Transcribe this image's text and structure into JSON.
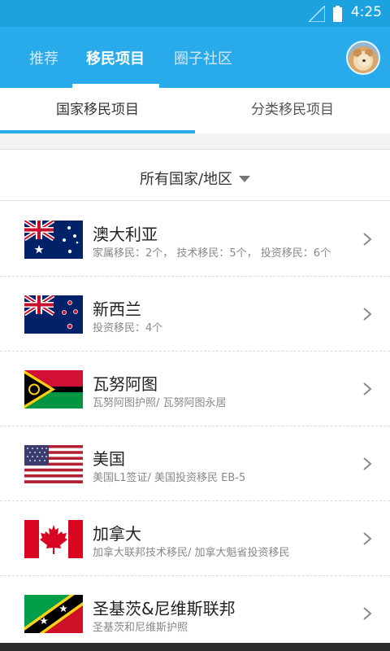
{
  "status_bar": {
    "time": "4:25"
  },
  "app_bar": {
    "tabs": [
      {
        "label": "推荐"
      },
      {
        "label": "移民项目"
      },
      {
        "label": "圈子社区"
      }
    ],
    "active_tab": "移民项目"
  },
  "sub_tabs": {
    "left": "国家移民项目",
    "right": "分类移民项目",
    "active": "国家移民项目"
  },
  "filter": {
    "label": "所有国家/地区"
  },
  "countries": [
    {
      "name": "澳大利亚",
      "desc": "家属移民：2个， 技术移民：5个， 投资移民：6个",
      "flag": "australia-flag"
    },
    {
      "name": "新西兰",
      "desc": "投资移民：4个",
      "flag": "new-zealand-flag"
    },
    {
      "name": "瓦努阿图",
      "desc": "瓦努阿图护照/ 瓦努阿图永居",
      "flag": "vanuatu-flag"
    },
    {
      "name": "美国",
      "desc": "美国L1签证/ 美国投资移民 EB-5",
      "flag": "usa-flag"
    },
    {
      "name": "加拿大",
      "desc": "加拿大联邦技术移民/ 加拿大魁省投资移民",
      "flag": "canada-flag"
    },
    {
      "name": "圣基茨&尼维斯联邦",
      "desc": "圣基茨和尼维斯护照",
      "flag": "saint-kitts-flag"
    }
  ],
  "colors": {
    "primary": "#29aaea",
    "status_bar": "#1da2e0",
    "text_primary": "#222222",
    "text_secondary": "#888888"
  }
}
